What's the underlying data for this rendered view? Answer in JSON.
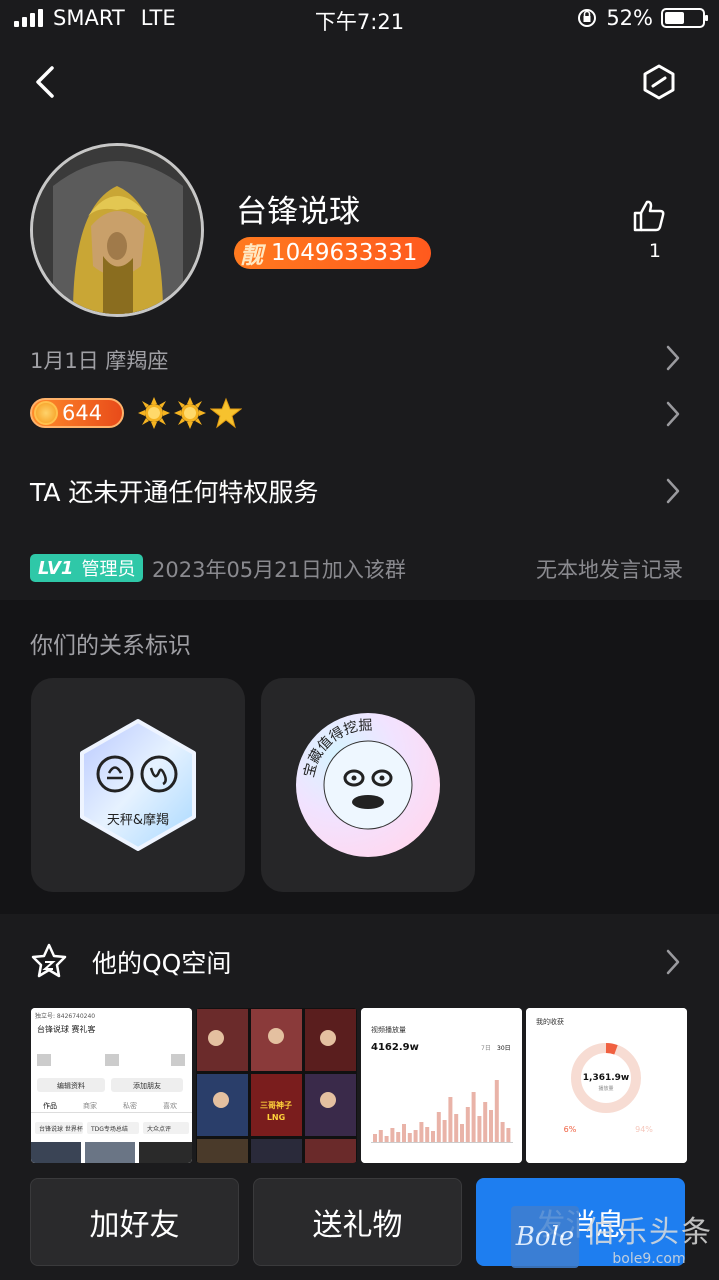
{
  "status_bar": {
    "carrier": "SMART",
    "network": "LTE",
    "time": "下午7:21",
    "battery": "52%",
    "battery_level": 0.52
  },
  "profile": {
    "name": "台锋说球",
    "qq_badge_prefix": "靓",
    "qq_number": "1049633331",
    "like_count": "1",
    "birthday_sign": "1月1日  摩羯座",
    "coin_value": "644",
    "privilege_text": "TA 还未开通任何特权服务",
    "admin_level": "LV1",
    "admin_role": "管理员",
    "join_text": "2023年05月21日加入该群",
    "no_record": "无本地发言记录"
  },
  "relation": {
    "title": "你们的关系标识",
    "card1_label": "天秤&摩羯",
    "card2_ring_text": "宝藏值得挖掘"
  },
  "qzone": {
    "title": "他的QQ空间",
    "thumb1": {
      "id_text": "独立号: 8426740240",
      "name": "台锋说球 赛礼客",
      "btn1": "编辑资料",
      "btn2": "添加朋友",
      "tab1": "作品",
      "tab2": "商家",
      "tab3": "私密",
      "tab4": "喜欢",
      "item1": "台锋说球 世界杯",
      "item2": "TDG专场总结",
      "item3": "大众点评"
    },
    "thumb2": {
      "caption1": "三哥神子",
      "caption2": "LNG"
    },
    "thumb3": {
      "title": "视频播放量",
      "value": "4162.9w",
      "tab1": "7日",
      "tab2": "30日"
    },
    "thumb4": {
      "title": "我的收获",
      "value": "1,361.9w",
      "sub": "播放量",
      "pct1": "6%",
      "pct2": "94%"
    }
  },
  "buttons": {
    "add_friend": "加好友",
    "send_gift": "送礼物",
    "send_message": "发消息"
  },
  "watermark": {
    "logo": "Bole",
    "cn": "伯乐头条",
    "url": "bole9.com"
  },
  "colors": {
    "accent_blue": "#1e7ef0",
    "badge_orange": "#ff6a1f",
    "admin_green": "#2fc8a8"
  }
}
